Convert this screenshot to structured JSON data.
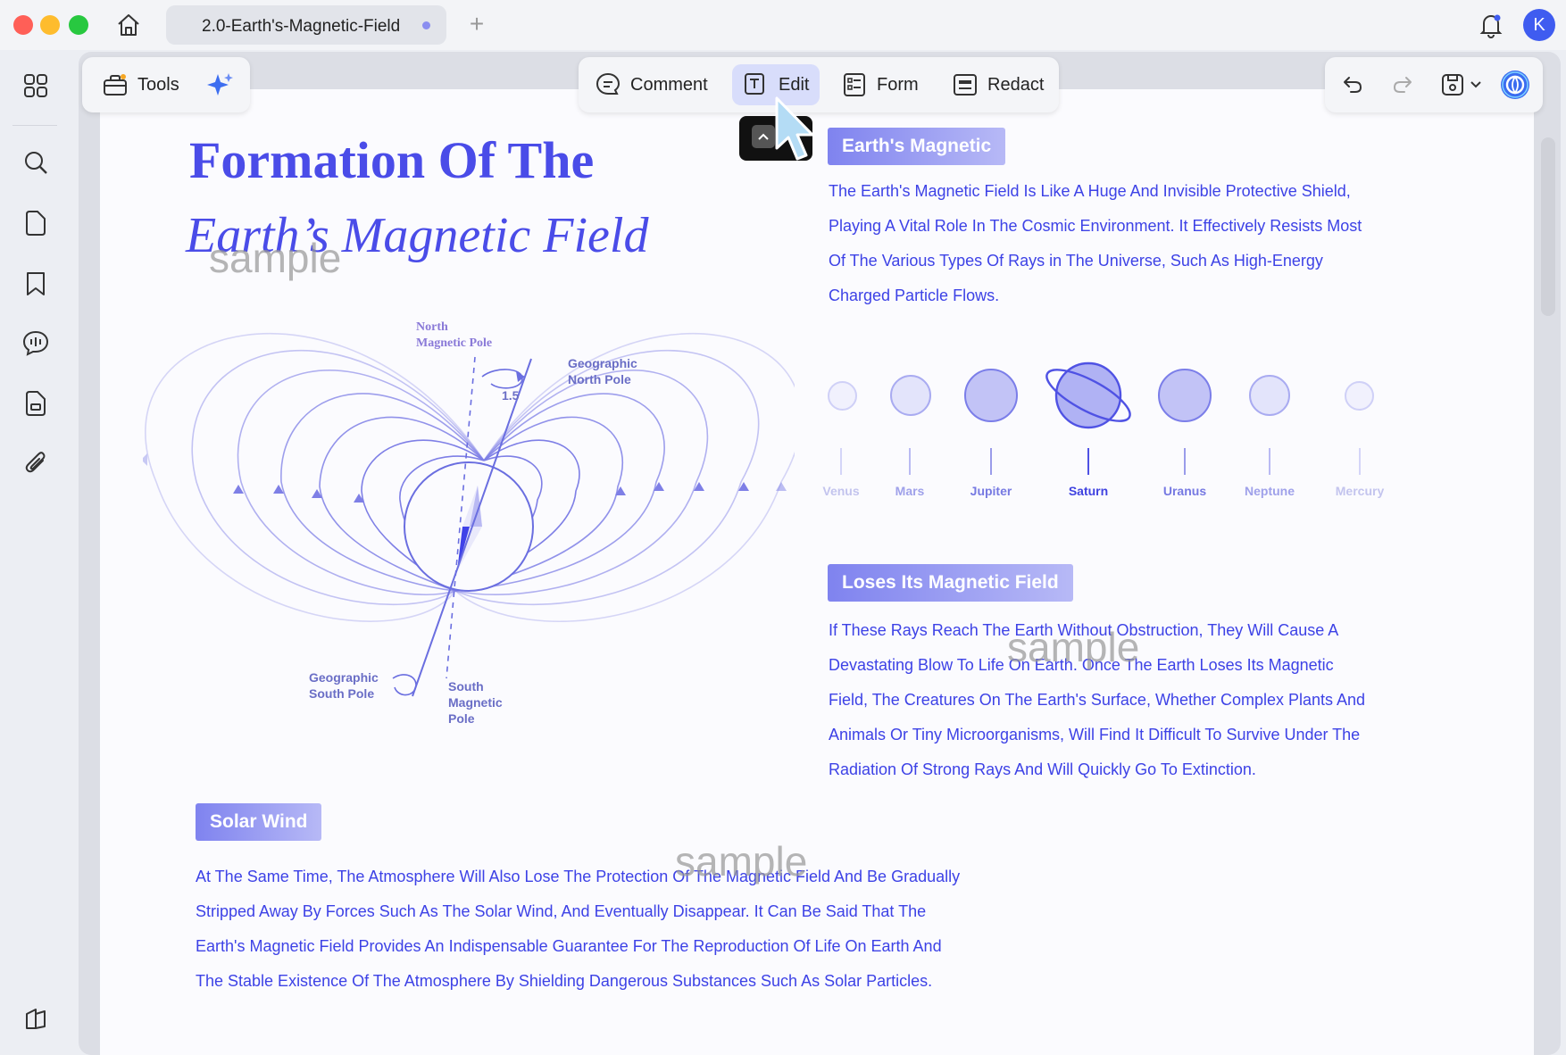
{
  "window": {
    "tab_title": "2.0-Earth's-Magnetic-Field",
    "avatar_initial": "K"
  },
  "toolbar": {
    "tools_label": "Tools",
    "comment_label": "Comment",
    "edit_label": "Edit",
    "form_label": "Form",
    "redact_label": "Redact"
  },
  "document": {
    "title_line1": "Formation Of The",
    "title_line2": "Earth’s Magnetic Field",
    "watermark": "sample",
    "diagram_labels": {
      "north_magnetic_pole": [
        "North",
        "Magnetic Pole"
      ],
      "geographic_north_pole": [
        "Geographic",
        "North Pole"
      ],
      "angle": "1.5",
      "geographic_south_pole": [
        "Geographic",
        "South Pole"
      ],
      "south_magnetic_pole": [
        "South",
        "Magnetic",
        "Pole"
      ]
    },
    "sections": {
      "earths_magnetic": {
        "heading": "Earth's Magnetic",
        "lines": [
          "The Earth's Magnetic Field Is Like A Huge And Invisible Protective Shield,",
          "Playing A Vital Role In The Cosmic Environment. It Effectively Resists Most",
          "Of The Various Types Of Rays in The Universe, Such As High-Energy",
          "Charged Particle Flows."
        ]
      },
      "loses_field": {
        "heading": "Loses Its Magnetic Field",
        "lines": [
          "If These Rays Reach The Earth Without Obstruction, They Will Cause A",
          "Devastating Blow To Life On Earth. Once The Earth Loses Its Magnetic",
          "Field, The Creatures On The Earth's Surface, Whether Complex Plants And",
          "Animals Or Tiny Microorganisms, Will Find It Difficult To Survive Under The",
          "Radiation Of Strong Rays And Will Quickly Go To Extinction."
        ]
      },
      "solar_wind": {
        "heading": "Solar Wind",
        "lines": [
          "At The Same Time, The Atmosphere Will Also Lose The Protection Of The Magnetic Field And Be Gradually",
          "Stripped Away By Forces Such As The Solar Wind, And Eventually Disappear. It Can Be Said That The",
          "Earth's Magnetic Field Provides An Indispensable Guarantee For The Reproduction Of Life On Earth And",
          "The Stable Existence Of The Atmosphere By Shielding Dangerous Substances Such As Solar Particles."
        ]
      }
    },
    "planets": [
      "Venus",
      "Mars",
      "Jupiter",
      "Saturn",
      "Uranus",
      "Neptune",
      "Mercury"
    ]
  },
  "colors": {
    "accent": "#4a4ce8",
    "text_blue": "#3d42e6",
    "label_gradient_start": "#7f83ef",
    "label_gradient_end": "#b7b9f6"
  }
}
